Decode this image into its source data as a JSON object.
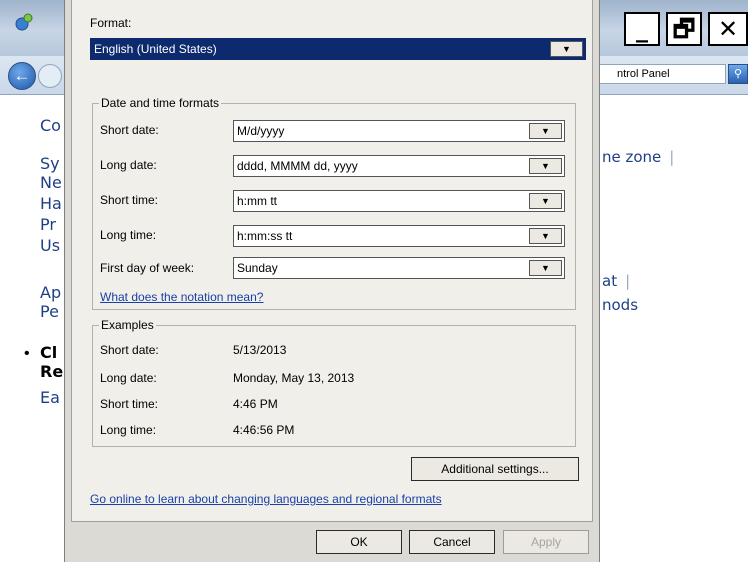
{
  "background_window": {
    "search_text": "ntrol Panel",
    "sidebar_fragments": [
      "Co",
      "Sy",
      "Ne",
      "Ha",
      "Pr",
      "Us",
      "Ap",
      "Pe",
      "Cl",
      "Re",
      "Ea"
    ],
    "link_fragments": [
      "ne zone",
      "at",
      "nods"
    ],
    "window_buttons": [
      "_",
      "🗗",
      "✕"
    ]
  },
  "dialog": {
    "format_label": "Format:",
    "format_value": "English (United States)",
    "date_time_group_title": "Date and time formats",
    "fields": [
      {
        "label": "Short date:",
        "value": "M/d/yyyy"
      },
      {
        "label": "Long date:",
        "value": "dddd, MMMM dd, yyyy"
      },
      {
        "label": "Short time:",
        "value": "h:mm tt"
      },
      {
        "label": "Long time:",
        "value": "h:mm:ss tt"
      },
      {
        "label": "First day of week:",
        "value": "Sunday"
      }
    ],
    "notation_link": "What does the notation mean?",
    "examples_group_title": "Examples",
    "examples": [
      {
        "label": "Short date:",
        "value": "5/13/2013"
      },
      {
        "label": "Long date:",
        "value": "Monday, May 13, 2013"
      },
      {
        "label": "Short time:",
        "value": "4:46 PM"
      },
      {
        "label": "Long time:",
        "value": "4:46:56 PM"
      }
    ],
    "additional_settings_button": "Additional settings...",
    "online_link": "Go online to learn about changing languages and regional formats",
    "ok_button": "OK",
    "cancel_button": "Cancel",
    "apply_button": "Apply"
  },
  "colors": {
    "selection": "#0d2a6f",
    "dialog_bg": "#f0efea",
    "link": "#1a3fa8"
  }
}
